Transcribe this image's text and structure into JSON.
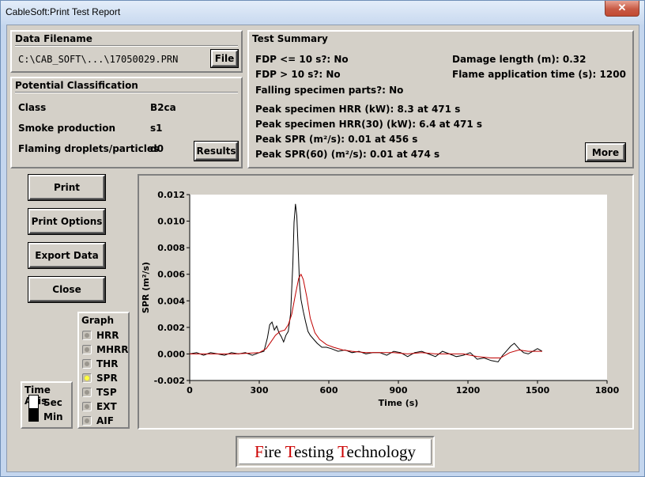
{
  "window": {
    "title": "CableSoft:Print Test Report",
    "close_glyph": "✕"
  },
  "data_filename": {
    "heading": "Data Filename",
    "path": "C:\\CAB_SOFT\\...\\17050029.PRN",
    "file_button": "File"
  },
  "classification": {
    "heading": "Potential Classification",
    "rows": [
      {
        "label": "Class",
        "value": "B2ca"
      },
      {
        "label": "Smoke production",
        "value": "s1"
      },
      {
        "label": "Flaming droplets/particles",
        "value": "d0"
      }
    ],
    "results_button": "Results"
  },
  "summary": {
    "heading": "Test Summary",
    "fdp10_lte": "FDP <= 10 s?: No",
    "fdp10_gt": "FDP > 10 s?: No",
    "falling": "Falling specimen parts?: No",
    "damage_length": "Damage length (m): 0.32",
    "flame_time": "Flame application time (s): 1200",
    "peak_hrr": "Peak specimen HRR (kW): 8.3 at 471 s",
    "peak_hrr30": "Peak specimen HRR(30) (kW): 6.4 at 471 s",
    "peak_spr": "Peak SPR (m²/s): 0.01 at 456 s",
    "peak_spr60": "Peak SPR(60) (m²/s): 0.01 at 474 s",
    "more_button": "More"
  },
  "actions": {
    "print": "Print",
    "print_options": "Print Options",
    "export": "Export Data",
    "close": "Close"
  },
  "graph_selector": {
    "heading": "Graph",
    "options": [
      "HRR",
      "MHRR",
      "THR",
      "SPR",
      "TSP",
      "EXT",
      "AIF"
    ],
    "selected": "SPR"
  },
  "time_axis": {
    "heading": "Time Axis",
    "options": [
      "Sec",
      "Min"
    ],
    "selected": "Min"
  },
  "brand": {
    "parts": [
      "F",
      "ire ",
      "T",
      "esting ",
      "T",
      "echnology"
    ]
  },
  "chart_data": {
    "type": "line",
    "xlabel": "Time (s)",
    "ylabel": "SPR (m²/s)",
    "xlim": [
      0,
      1800
    ],
    "ylim": [
      -0.002,
      0.012
    ],
    "xticks": [
      0,
      300,
      600,
      900,
      1200,
      1500,
      1800
    ],
    "yticks": [
      -0.002,
      0.0,
      0.002,
      0.004,
      0.006,
      0.008,
      0.01,
      0.012
    ],
    "ytick_labels": [
      "-0.002",
      "0.000",
      "0.002",
      "0.004",
      "0.006",
      "0.008",
      "0.010",
      "0.012"
    ],
    "grid": false,
    "series": [
      {
        "color": "#000000",
        "x": [
          0,
          30,
          60,
          90,
          120,
          150,
          180,
          210,
          240,
          270,
          300,
          320,
          335,
          345,
          355,
          365,
          375,
          385,
          395,
          405,
          415,
          425,
          435,
          445,
          450,
          456,
          462,
          468,
          474,
          480,
          490,
          500,
          510,
          520,
          535,
          550,
          570,
          590,
          610,
          640,
          670,
          700,
          730,
          760,
          790,
          820,
          850,
          880,
          910,
          940,
          970,
          1000,
          1030,
          1060,
          1090,
          1120,
          1150,
          1180,
          1210,
          1240,
          1270,
          1300,
          1330,
          1350,
          1370,
          1385,
          1400,
          1420,
          1440,
          1460,
          1480,
          1500,
          1520
        ],
        "y": [
          0.0,
          0.0001,
          -0.0001,
          0.0001,
          0.0,
          -0.0001,
          0.0001,
          0.0,
          0.0001,
          -0.0001,
          0.0001,
          0.0002,
          0.0012,
          0.0022,
          0.0024,
          0.0018,
          0.0021,
          0.0016,
          0.0013,
          0.0009,
          0.0014,
          0.0017,
          0.003,
          0.0068,
          0.0099,
          0.0113,
          0.0104,
          0.0078,
          0.0052,
          0.0041,
          0.0032,
          0.0024,
          0.0017,
          0.0014,
          0.0011,
          0.0008,
          0.0005,
          0.0005,
          0.0004,
          0.0002,
          0.0003,
          0.0001,
          0.0002,
          0.0,
          0.0001,
          0.0001,
          -0.0001,
          0.0002,
          0.0001,
          -0.0002,
          0.0001,
          0.0002,
          0.0,
          -0.0002,
          0.0002,
          0.0,
          -0.0002,
          -0.0001,
          0.0001,
          -0.0004,
          -0.0003,
          -0.0005,
          -0.0006,
          -0.0001,
          0.0003,
          0.0006,
          0.0008,
          0.0004,
          0.0001,
          0.0,
          0.0002,
          0.0004,
          0.0002
        ]
      },
      {
        "color": "#c00000",
        "x": [
          0,
          100,
          200,
          300,
          330,
          350,
          370,
          390,
          410,
          425,
          440,
          455,
          470,
          480,
          490,
          505,
          520,
          540,
          560,
          590,
          620,
          660,
          700,
          760,
          820,
          880,
          940,
          1000,
          1060,
          1120,
          1180,
          1240,
          1300,
          1340,
          1380,
          1420,
          1460,
          1500,
          1520
        ],
        "y": [
          0.0,
          0.0,
          0.0,
          0.0001,
          0.0004,
          0.0009,
          0.0014,
          0.0017,
          0.0018,
          0.0022,
          0.003,
          0.0044,
          0.0057,
          0.006,
          0.0056,
          0.0043,
          0.0027,
          0.0016,
          0.0011,
          0.0007,
          0.0005,
          0.0003,
          0.0002,
          0.0001,
          0.0001,
          0.0001,
          0.0,
          0.0001,
          0.0,
          0.0,
          0.0,
          -0.0002,
          -0.0003,
          -0.0003,
          0.0001,
          0.0003,
          0.0002,
          0.0002,
          0.0002
        ]
      }
    ]
  }
}
